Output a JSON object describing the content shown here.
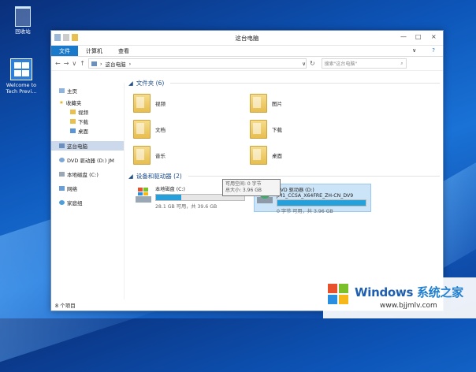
{
  "desktop": {
    "recycle_label": "回收站",
    "welcome_label_1": "Welcome to",
    "welcome_label_2": "Tech Previ..."
  },
  "window": {
    "title": "这台电脑",
    "minimize_glyph": "—",
    "maximize_glyph": "□",
    "close_glyph": "×",
    "help_glyph": "?",
    "expand_ribbon_glyph": "∨"
  },
  "ribbon": {
    "tabs": [
      "文件",
      "计算机",
      "查看"
    ]
  },
  "address": {
    "back": "←",
    "forward": "→",
    "dropdown": "∨",
    "up": "↑",
    "path": "这台电脑",
    "separator": "›",
    "path_dropdown": "∨",
    "refresh": "↻",
    "search_placeholder": "搜索\"这台电脑\"",
    "search_icon": "⌕"
  },
  "nav": {
    "home": "主页",
    "favorites": "收藏夹",
    "fav_items": [
      "视频",
      "下载",
      "桌面"
    ],
    "this_pc": "这台电脑",
    "dvd": "DVD 驱动器 (D:) JM",
    "local_disk": "本地磁盘 (C:)",
    "network": "网络",
    "homegroup": "家庭组"
  },
  "folders_group": {
    "title": "文件夹 (6)",
    "items": [
      "视频",
      "图片",
      "文档",
      "下载",
      "音乐",
      "桌面"
    ]
  },
  "drives_group": {
    "title": "设备和驱动器 (2)",
    "c": {
      "name": "本地磁盘 (C:)",
      "free": "28.1 GB 可用，共 39.6 GB",
      "used_fraction": 0.29
    },
    "d": {
      "name": "DVD 驱动器 (D:)",
      "label": "JM1_CCSA_X64FRE_ZH-CN_DV9",
      "free": "0 字节 可用，共 3.96 GB",
      "used_fraction": 1.0
    }
  },
  "tooltip": {
    "line1": "可用空间: 0 字节",
    "line2": "总大小: 3.96 GB"
  },
  "status": {
    "count": "8 个项目"
  },
  "watermark": {
    "title_a": "Windows",
    "title_b": "系统之家",
    "url": "www.bjjmlv.com"
  },
  "colors": {
    "accent": "#1979ca",
    "bar": "#26a0da",
    "selection": "#cce4f7"
  }
}
